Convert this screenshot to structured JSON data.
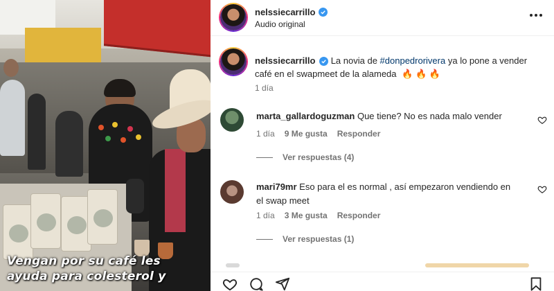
{
  "media": {
    "caption_line1": "Vengan por su café  les",
    "caption_line2": "ayuda para colesterol y"
  },
  "header": {
    "username": "nelssiecarrillo",
    "subtitle": "Audio original"
  },
  "post": {
    "username": "nelssiecarrillo",
    "text_before": "La novia de ",
    "hashtag": "#donpedrorivera",
    "text_after": " ya lo pone a vender café en el swapmeet de la alameda",
    "emoji": "🔥 🔥 🔥",
    "time": "1 día"
  },
  "comments": [
    {
      "username": "marta_gallardoguzman",
      "text": "Que tiene? No es nada malo vender",
      "time": "1 día",
      "likes": "9 Me gusta",
      "reply": "Responder",
      "view_replies": "Ver respuestas (4)"
    },
    {
      "username": "mari79mr",
      "text_line1": "Eso para el es normal , así empezaron vendiendo en",
      "text_line2": "el swap meet",
      "time": "1 día",
      "likes": "3 Me gusta",
      "reply": "Responder",
      "view_replies": "Ver respuestas (1)"
    }
  ],
  "colors": {
    "text": "#262626",
    "muted": "#737373",
    "hashtag": "#00376b",
    "verified": "#3897f0"
  },
  "icons": [
    "verified-icon",
    "more-options-icon",
    "heart-icon",
    "comment-icon",
    "share-icon",
    "bookmark-icon",
    "fire-emoji"
  ]
}
